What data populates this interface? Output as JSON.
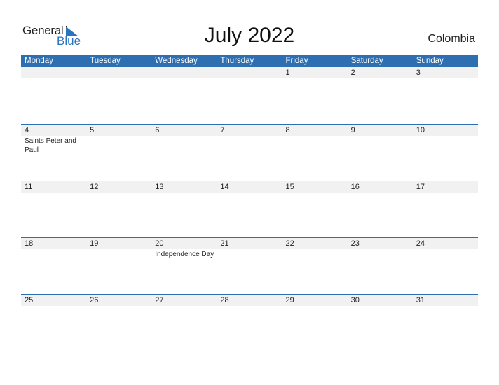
{
  "logo": {
    "line1": "General",
    "line2": "Blue"
  },
  "title": "July 2022",
  "country": "Colombia",
  "colors": {
    "header_bg": "#2e6fb1",
    "day_row_bg": "#f1f1f1",
    "brand_blue": "#2a73be"
  },
  "weekdays": [
    "Monday",
    "Tuesday",
    "Wednesday",
    "Thursday",
    "Friday",
    "Saturday",
    "Sunday"
  ],
  "weeks": [
    {
      "days": [
        "",
        "",
        "",
        "",
        "1",
        "2",
        "3"
      ],
      "events": [
        "",
        "",
        "",
        "",
        "",
        "",
        ""
      ]
    },
    {
      "days": [
        "4",
        "5",
        "6",
        "7",
        "8",
        "9",
        "10"
      ],
      "events": [
        "Saints Peter and Paul",
        "",
        "",
        "",
        "",
        "",
        ""
      ]
    },
    {
      "days": [
        "11",
        "12",
        "13",
        "14",
        "15",
        "16",
        "17"
      ],
      "events": [
        "",
        "",
        "",
        "",
        "",
        "",
        ""
      ]
    },
    {
      "days": [
        "18",
        "19",
        "20",
        "21",
        "22",
        "23",
        "24"
      ],
      "events": [
        "",
        "",
        "Independence Day",
        "",
        "",
        "",
        ""
      ]
    },
    {
      "days": [
        "25",
        "26",
        "27",
        "28",
        "29",
        "30",
        "31"
      ],
      "events": [
        "",
        "",
        "",
        "",
        "",
        "",
        ""
      ]
    }
  ]
}
